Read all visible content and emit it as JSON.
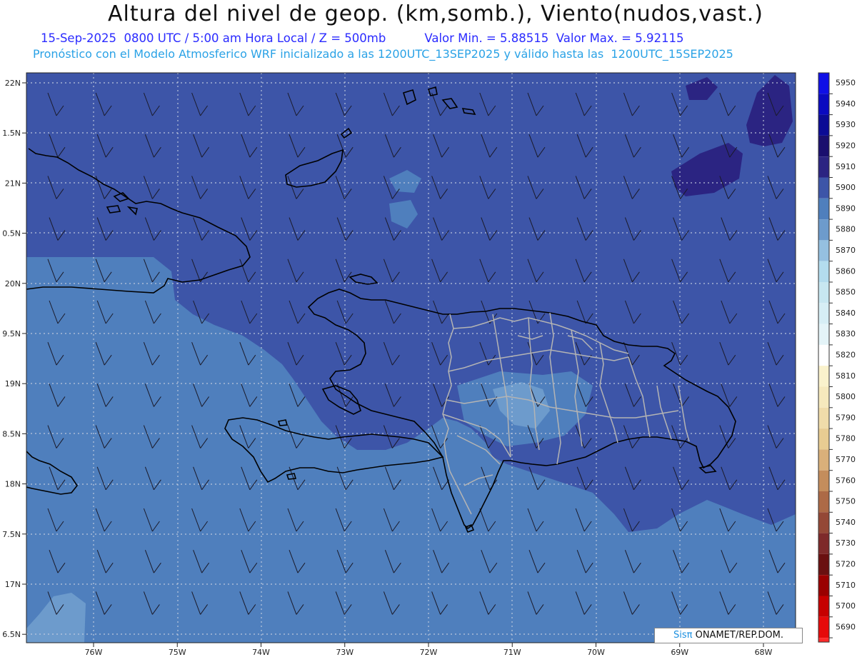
{
  "title": "Altura del nivel de geop. (km,somb.), Viento(nudos,vast.)",
  "subtitle": {
    "date": "15-Sep-2025",
    "time": "0800 UTC / 5:00 am Hora Local / Z = 500mb",
    "valor_min": "Valor Min. = 5.88515",
    "valor_max": "Valor Max. = 5.92115"
  },
  "model_line": "Pronóstico con el Modelo Atmosferico WRF inicializado a las 1200UTC_13SEP2025 y válido hasta las  1200UTC_15SEP2025",
  "credit": {
    "logo": "Sisπ",
    "text": " ONAMET/REP.DOM."
  },
  "axes": {
    "lat_labels": [
      "22N",
      "1.5N",
      "21N",
      "0.5N",
      "20N",
      "9.5N",
      "19N",
      "8.5N",
      "18N",
      "7.5N",
      "17N",
      "6.5N"
    ],
    "lon_labels": [
      "76W",
      "75W",
      "74W",
      "73W",
      "72W",
      "71W",
      "70W",
      "69W",
      "68W"
    ]
  },
  "colorbar": {
    "levels": [
      {
        "label": "5950",
        "color": "#0f0fe6"
      },
      {
        "label": "5940",
        "color": "#0a0ac0"
      },
      {
        "label": "5930",
        "color": "#0b0b95"
      },
      {
        "label": "5920",
        "color": "#1a0f6e"
      },
      {
        "label": "5910",
        "color": "#2b2482"
      },
      {
        "label": "5900",
        "color": "#3d55a8"
      },
      {
        "label": "5890",
        "color": "#4f7fbd"
      },
      {
        "label": "5880",
        "color": "#6d9bcc"
      },
      {
        "label": "5870",
        "color": "#95c0e0"
      },
      {
        "label": "5860",
        "color": "#b3dcee"
      },
      {
        "label": "5850",
        "color": "#c7e7f1"
      },
      {
        "label": "5840",
        "color": "#d6eef5"
      },
      {
        "label": "5830",
        "color": "#e4f4f8"
      },
      {
        "label": "5820",
        "color": "#ffffff"
      },
      {
        "label": "5810",
        "color": "#faf2cc"
      },
      {
        "label": "5800",
        "color": "#f6e9bd"
      },
      {
        "label": "5790",
        "color": "#f0dcaa"
      },
      {
        "label": "5780",
        "color": "#e8cc92"
      },
      {
        "label": "5770",
        "color": "#d9b07a"
      },
      {
        "label": "5760",
        "color": "#c48d5c"
      },
      {
        "label": "5750",
        "color": "#ad6a46"
      },
      {
        "label": "5740",
        "color": "#944836"
      },
      {
        "label": "5730",
        "color": "#7e2a2a"
      },
      {
        "label": "5720",
        "color": "#6a1010"
      },
      {
        "label": "5710",
        "color": "#9a0000"
      },
      {
        "label": "5700",
        "color": "#c60000"
      },
      {
        "label": "5690",
        "color": "#e60a0a"
      }
    ],
    "bottom_color": "#ff2a2a"
  },
  "colors": {
    "field_main": "#3d55a8",
    "field_light": "#4f7fbd",
    "field_lighter": "#6d9bcc",
    "field_dark": "#2b2482",
    "grid": "#c8d0e0",
    "coast": "#000000",
    "borders": "#b4b4b4"
  }
}
